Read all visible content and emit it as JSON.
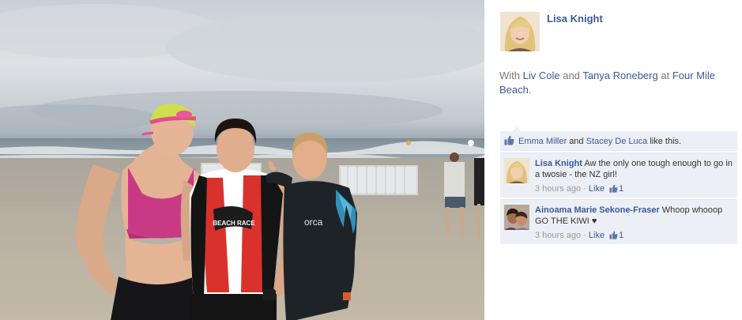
{
  "post": {
    "author": "Lisa Knight",
    "caption_prefix": "With",
    "tagged_1": "Liv Cole",
    "caption_and": "and",
    "tagged_2": "Tanya Roneberg",
    "caption_at": "at",
    "location": "Four Mile Beach",
    "caption_end": "."
  },
  "likes": {
    "user_1": "Emma Miller",
    "and": "and",
    "user_2": "Stacey De Luca",
    "suffix": "like this."
  },
  "comments": [
    {
      "author": "Lisa Knight",
      "text": "Aw the only one tough enough to go in a twosie - the NZ girl!",
      "time": "3 hours ago",
      "sep": "·",
      "like_label": "Like",
      "like_count": "1"
    },
    {
      "author": "Ainoama Marie Sekone-Fraser",
      "text": "Whoop whooop GO THE KIWI ♥",
      "time": "3 hours ago",
      "sep": "·",
      "like_label": "Like",
      "like_count": "1"
    }
  ],
  "photo": {
    "swim_cap_text": "",
    "wetsuit_brand": "orca",
    "tri_suit_text": "BEACH RACE"
  },
  "colors": {
    "link_blue": "#3b5998",
    "ufi_bg": "#eceff5",
    "caption_gray": "#777777"
  }
}
